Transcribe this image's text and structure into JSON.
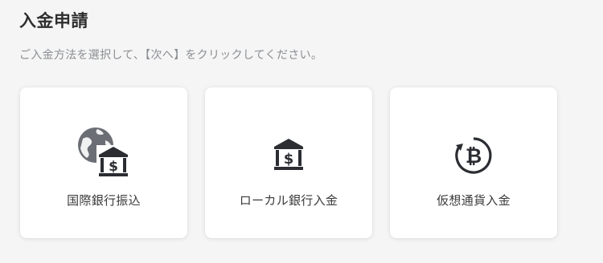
{
  "page": {
    "title": "入金申請",
    "instruction": "ご入金方法を選択して、【次へ】をクリックしてください。"
  },
  "methods": [
    {
      "label": "国際銀行振込",
      "icon": "globe-bank-icon"
    },
    {
      "label": "ローカル銀行入金",
      "icon": "bank-icon"
    },
    {
      "label": "仮想通貨入金",
      "icon": "bitcoin-icon"
    }
  ],
  "colors": {
    "icon_dark": "#2b2d33",
    "icon_gray": "#6b6e75",
    "text": "#3a3a3a",
    "muted": "#8a8e93"
  }
}
